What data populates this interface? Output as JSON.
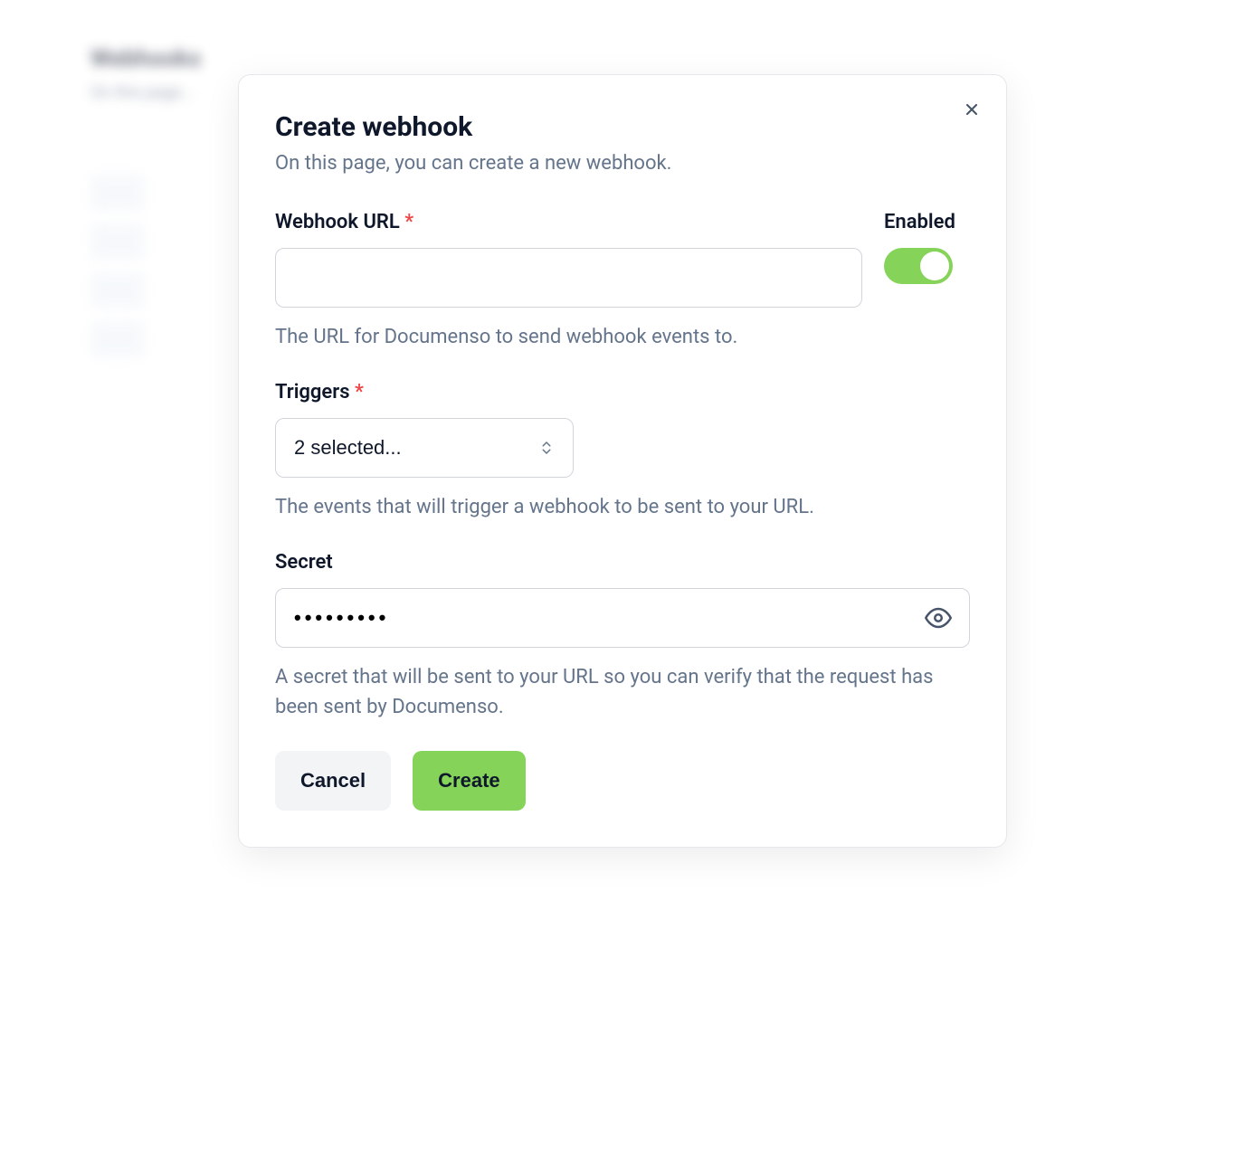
{
  "background": {
    "title": "Webhooks"
  },
  "modal": {
    "title": "Create webhook",
    "subtitle": "On this page, you can create a new webhook.",
    "url": {
      "label": "Webhook URL",
      "required": "*",
      "value": "",
      "help": "The URL for Documenso to send webhook events to."
    },
    "enabled": {
      "label": "Enabled",
      "value": true
    },
    "triggers": {
      "label": "Triggers",
      "required": "*",
      "selected": "2 selected...",
      "help": "The events that will trigger a webhook to be sent to your URL."
    },
    "secret": {
      "label": "Secret",
      "value": "•••••••••",
      "help": "A secret that will be sent to your URL so you can verify that the request has been sent by Documenso."
    },
    "buttons": {
      "cancel": "Cancel",
      "create": "Create"
    }
  }
}
